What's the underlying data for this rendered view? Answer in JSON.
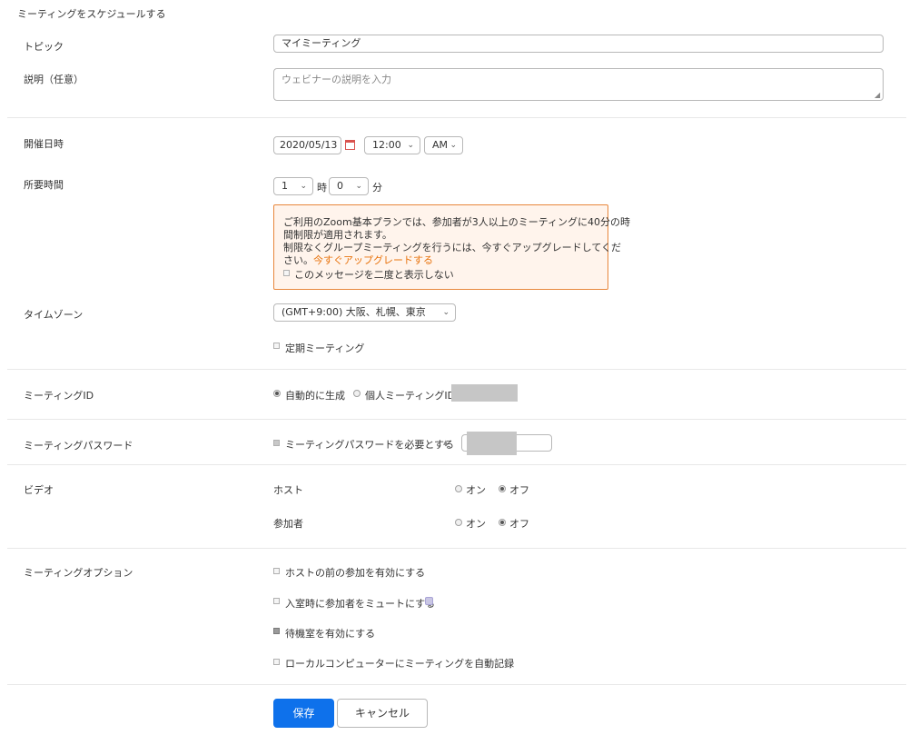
{
  "page_title": "ミーティングをスケジュールする",
  "topic": {
    "label": "トピック",
    "value": "マイミーティング"
  },
  "description": {
    "label": "説明（任意）",
    "placeholder": "ウェビナーの説明を入力"
  },
  "date_time": {
    "label": "開催日時",
    "date": "2020/05/13",
    "time": "12:00",
    "ampm": "AM"
  },
  "duration": {
    "label": "所要時間",
    "hours": "1",
    "hours_unit": "時",
    "minutes": "0",
    "minutes_unit": "分"
  },
  "notice": {
    "line1": "ご利用のZoom基本プランでは、参加者が3人以上のミーティングに40分の時",
    "line2": "間制限が適用されます。",
    "line3": "制限なくグループミーティングを行うには、今すぐアップグレードしてくだ",
    "line4_prefix": "さい。",
    "link": "今すぐアップグレードする",
    "dont_show": "このメッセージを二度と表示しない"
  },
  "timezone": {
    "label": "タイムゾーン",
    "value": "(GMT+9:00) 大阪、札幌、東京"
  },
  "recurring": {
    "label": "定期ミーティング"
  },
  "meeting_id": {
    "label": "ミーティングID",
    "auto": "自動的に生成",
    "personal": "個人ミーティングID"
  },
  "password": {
    "label": "ミーティングパスワード",
    "require": "ミーティングパスワードを必要とする",
    "marker": "▲"
  },
  "video": {
    "label": "ビデオ",
    "host": "ホスト",
    "participant": "参加者",
    "on": "オン",
    "off": "オフ"
  },
  "options": {
    "label": "ミーティングオプション",
    "join_before_host": "ホストの前の参加を有効にする",
    "mute_on_entry": "入室時に参加者をミュートにする",
    "waiting_room": "待機室を有効にする",
    "auto_record": "ローカルコンピューターにミーティングを自動記録"
  },
  "buttons": {
    "save": "保存",
    "cancel": "キャンセル"
  },
  "colors": {
    "primary": "#0e71eb",
    "notice_border": "#e8873c",
    "notice_bg": "#fff4ec",
    "link": "#e8730d"
  }
}
